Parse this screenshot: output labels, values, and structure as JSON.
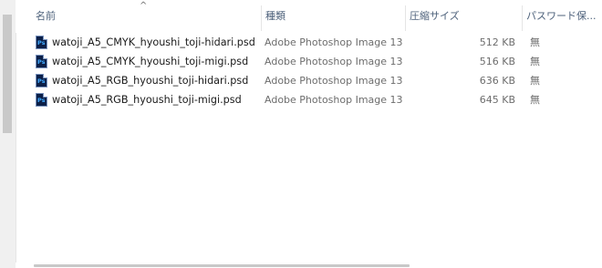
{
  "columns": {
    "name": "名前",
    "type": "種類",
    "size": "圧縮サイズ",
    "password": "パスワード保..."
  },
  "files": [
    {
      "name": "watoji_A5_CMYK_hyoushi_toji-hidari.psd",
      "type": "Adobe Photoshop Image 13",
      "size": "512 KB",
      "password": "無",
      "icon": "photoshop-file-icon"
    },
    {
      "name": "watoji_A5_CMYK_hyoushi_toji-migi.psd",
      "type": "Adobe Photoshop Image 13",
      "size": "516 KB",
      "password": "無",
      "icon": "photoshop-file-icon"
    },
    {
      "name": "watoji_A5_RGB_hyoushi_toji-hidari.psd",
      "type": "Adobe Photoshop Image 13",
      "size": "636 KB",
      "password": "無",
      "icon": "photoshop-file-icon"
    },
    {
      "name": "watoji_A5_RGB_hyoushi_toji-migi.psd",
      "type": "Adobe Photoshop Image 13",
      "size": "645 KB",
      "password": "無",
      "icon": "photoshop-file-icon"
    }
  ],
  "icon_label": "Ps",
  "sort_indicator": "^"
}
